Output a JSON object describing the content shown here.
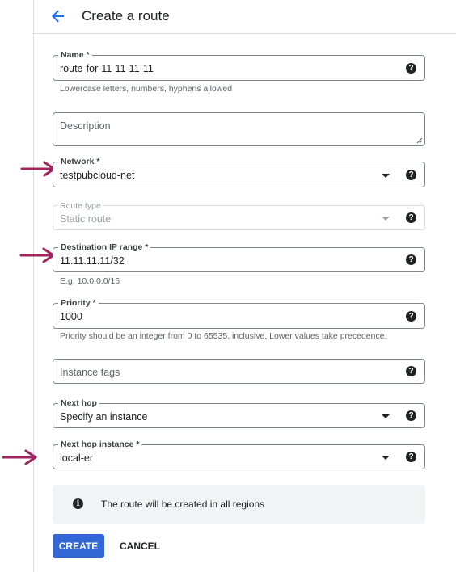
{
  "header": {
    "title": "Create a route"
  },
  "fields": {
    "name": {
      "label": "Name *",
      "value": "route-for-11-11-11-11",
      "hint": "Lowercase letters, numbers, hyphens allowed"
    },
    "description": {
      "placeholder": "Description"
    },
    "network": {
      "label": "Network *",
      "value": "testpubcloud-net"
    },
    "route_type": {
      "label": "Route type",
      "value": "Static route"
    },
    "destination": {
      "label": "Destination IP range *",
      "value": "11.11.11.11/32",
      "hint": "E.g. 10.0.0.0/16"
    },
    "priority": {
      "label": "Priority *",
      "value": "1000",
      "hint": "Priority should be an integer from 0 to 65535, inclusive. Lower values take precedence."
    },
    "instance_tags": {
      "placeholder": "Instance tags"
    },
    "next_hop": {
      "label": "Next hop",
      "value": "Specify an instance"
    },
    "next_hop_instance": {
      "label": "Next hop instance *",
      "value": "local-er"
    }
  },
  "info": {
    "text": "The route will be created in all regions"
  },
  "actions": {
    "create": "CREATE",
    "cancel": "CANCEL"
  },
  "colors": {
    "primary": "#3367d6",
    "annotation_arrow": "#a0245d",
    "back_arrow": "#1a73e8"
  },
  "icons": {
    "back": "arrow-left-icon",
    "help": "help-circle-icon",
    "dropdown": "caret-down-icon",
    "info": "info-icon"
  }
}
